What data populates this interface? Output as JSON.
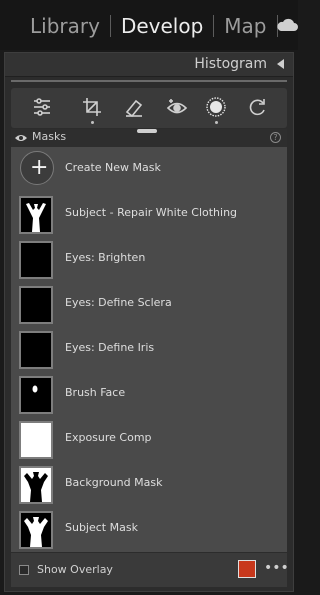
{
  "modules": {
    "library": "Library",
    "develop": "Develop",
    "map": "Map",
    "active": "Develop"
  },
  "histogram": {
    "title": "Histogram"
  },
  "tools": [
    {
      "name": "edit-sliders-icon"
    },
    {
      "name": "crop-icon"
    },
    {
      "name": "healing-icon"
    },
    {
      "name": "red-eye-icon"
    },
    {
      "name": "masking-icon",
      "active": true
    },
    {
      "name": "presets-icon"
    }
  ],
  "masks": {
    "title": "Masks",
    "help": "?",
    "create_label": "Create New Mask",
    "items": [
      {
        "label": "Subject - Repair White Clothing",
        "thumb": "subject-white"
      },
      {
        "label": "Eyes: Brighten",
        "thumb": "black"
      },
      {
        "label": "Eyes: Define Sclera",
        "thumb": "black"
      },
      {
        "label": "Eyes: Define Iris",
        "thumb": "black"
      },
      {
        "label": "Brush Face",
        "thumb": "dot"
      },
      {
        "label": "Exposure Comp",
        "thumb": "white"
      },
      {
        "label": "Background Mask",
        "thumb": "background"
      },
      {
        "label": "Subject Mask",
        "thumb": "subject"
      }
    ]
  },
  "overlay": {
    "label": "Show Overlay",
    "checked": false,
    "color": "#c8381c",
    "more": "•••"
  },
  "colors": {
    "accent_overlay": "#c8381c",
    "panel_bg": "#2c2c2c",
    "list_bg": "#4a4a4a"
  }
}
